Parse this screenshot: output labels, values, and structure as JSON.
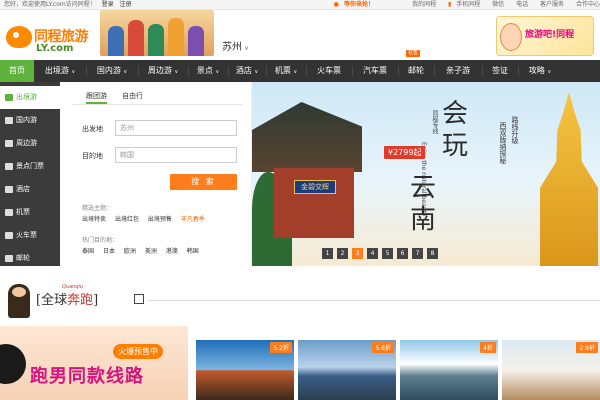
{
  "topbar": {
    "greeting": "您好，欢迎使用LY.com访问同程！",
    "login": "登录",
    "register": "注册",
    "promo": "等你来抢！",
    "my_tongcheng": "我的同程",
    "mobile": "手机同程",
    "wechat": "微信",
    "phone": "电话",
    "service": "客户服务",
    "cooperation": "合作中心"
  },
  "header": {
    "logo_name": "同程旅游",
    "logo_domain": "LY.com",
    "city": "苏州",
    "city_arrow": "∨",
    "ad_text": "旅游吧!同程"
  },
  "nav": {
    "items": [
      "首页",
      "出境游",
      "国内游",
      "周边游",
      "景点",
      "酒店",
      "机票",
      "火车票",
      "汽车票",
      "邮轮",
      "亲子游",
      "签证",
      "攻略"
    ],
    "badge": "在售",
    "arrow": "∨"
  },
  "side": {
    "items": [
      "出境游",
      "国内游",
      "周边游",
      "景点门票",
      "酒店",
      "机票",
      "火车票",
      "邮轮"
    ]
  },
  "search": {
    "tab_group": "跟团游",
    "tab_free": "自由行",
    "from_label": "出发地",
    "from_value": "苏州",
    "to_label": "目的地",
    "to_value": "韩国",
    "button": "搜 索",
    "themes_label": "精选主题：",
    "themes": [
      "出境特卖",
      "出境红包",
      "出境预售",
      "非凡春季"
    ],
    "hot_label": "热门目的地：",
    "hot": [
      "泰国",
      "日本",
      "欧洲",
      "美洲",
      "港澳",
      "韩国"
    ]
  },
  "hero": {
    "headline1": "会玩",
    "headline2": "云南",
    "price": "¥2799起",
    "plaque": "金碧交辉",
    "upgrade1": "路线升级",
    "upgrade2": "西双版纳探秘",
    "tag_cn": "同程专线",
    "tag_en": "Enjoy the natural beauty",
    "dots": [
      "1",
      "2",
      "3",
      "4",
      "5",
      "6",
      "7",
      "8"
    ],
    "active_dot": 2
  },
  "section": {
    "title_a": "全球",
    "title_b": "奔跑",
    "subtitle": "Quanqiu",
    "bracket_l": "[",
    "bracket_r": "]"
  },
  "promo": {
    "hot": "火爆预售中",
    "calligraphy": "跑男同款线路"
  },
  "cards": [
    {
      "discount": "5.2折",
      "colors": [
        "#1f6fb8",
        "#c45a2a"
      ]
    },
    {
      "discount": "5.8折",
      "colors": [
        "#6d9cc9",
        "#3a5f85"
      ]
    },
    {
      "discount": "4折",
      "colors": [
        "#8fc7e8",
        "#2d4d5e"
      ]
    },
    {
      "discount": "2.9折",
      "colors": [
        "#dbe9f2",
        "#b48c5e"
      ]
    }
  ]
}
